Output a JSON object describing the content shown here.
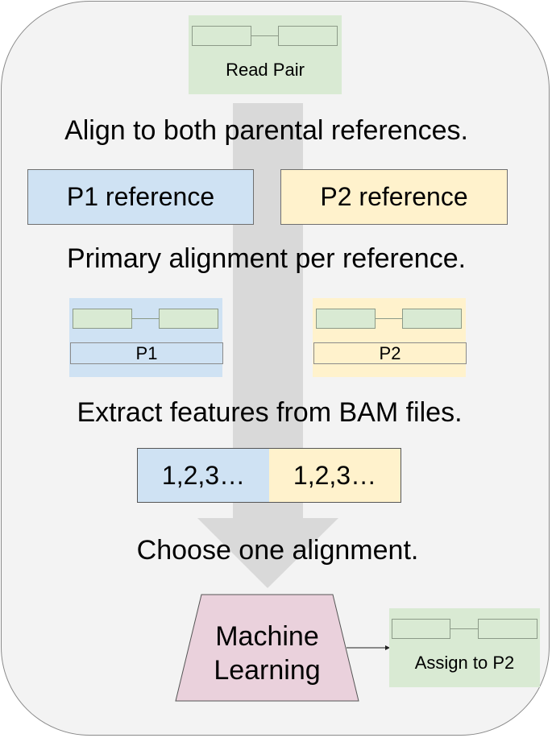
{
  "diagram": {
    "input": {
      "label": "Read Pair"
    },
    "steps": [
      "Align to both parental references.",
      "Primary alignment per reference.",
      "Extract features from BAM files.",
      "Choose one alignment."
    ],
    "references": [
      {
        "label": "P1 reference",
        "color": "#cfe2f3"
      },
      {
        "label": "P2 reference",
        "color": "#fff2cc"
      }
    ],
    "alignments": [
      {
        "label": "P1",
        "color": "#cfe2f3"
      },
      {
        "label": "P2",
        "color": "#fff2cc"
      }
    ],
    "features": [
      {
        "label": "1,2,3…",
        "color": "#cfe2f3"
      },
      {
        "label": "1,2,3…",
        "color": "#fff2cc"
      }
    ],
    "classifier": {
      "label_line1": "Machine",
      "label_line2": "Learning",
      "color": "#ead1dc"
    },
    "output": {
      "label": "Assign to P2",
      "color": "#d9ead3"
    }
  }
}
